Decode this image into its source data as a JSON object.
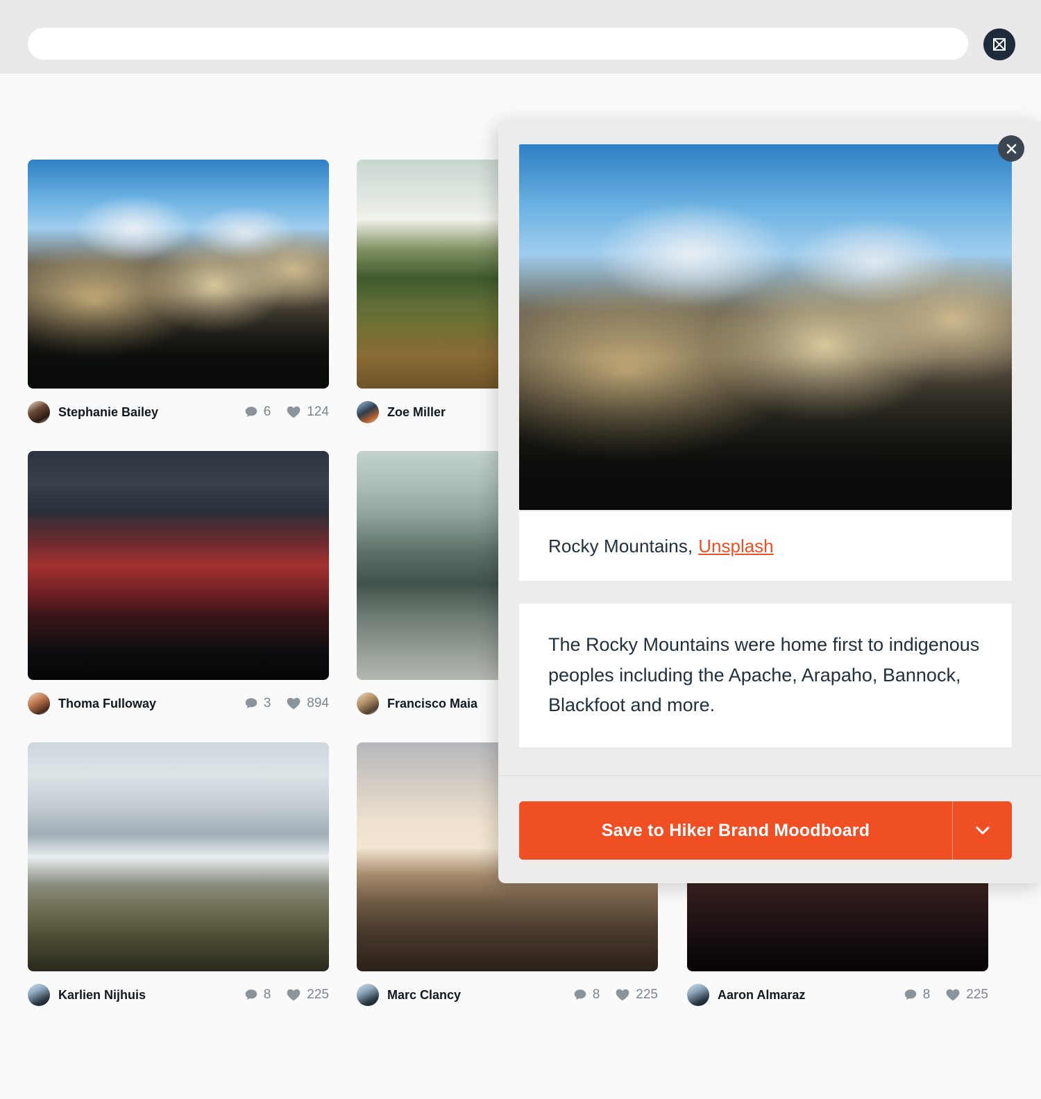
{
  "topbar": {
    "search_value": "",
    "search_placeholder": "",
    "brand_icon": "crown-m-logo-icon"
  },
  "gallery": {
    "cards": [
      {
        "id": "rocky-mountains",
        "author": "Stephanie Bailey",
        "comments": "6",
        "likes": "124",
        "photo": "pg-rocky",
        "avatar": "av-1",
        "col": 0,
        "row": 0
      },
      {
        "id": "poppy-field",
        "author": "Zoe Miller",
        "comments": "",
        "likes": "",
        "photo": "pg-poppy",
        "avatar": "av-2",
        "col": 1,
        "row": 0
      },
      {
        "id": "red-ridge",
        "author": "Thoma Fulloway",
        "comments": "3",
        "likes": "894",
        "photo": "pg-redridge",
        "avatar": "av-3",
        "col": 0,
        "row": 1
      },
      {
        "id": "foggy-forest",
        "author": "Francisco Maia",
        "comments": "",
        "likes": "",
        "photo": "pg-fog",
        "avatar": "av-4",
        "col": 1,
        "row": 1
      },
      {
        "id": "alpine-valley",
        "author": "Karlien Nijhuis",
        "comments": "8",
        "likes": "225",
        "photo": "pg-alpine",
        "avatar": "av-5",
        "col": 0,
        "row": 2
      },
      {
        "id": "cloud-peak",
        "author": "Marc Clancy",
        "comments": "8",
        "likes": "225",
        "photo": "pg-cloudpeak",
        "avatar": "av-6",
        "col": 1,
        "row": 2
      },
      {
        "id": "maroon-range",
        "author": "Aaron Almaraz",
        "comments": "8",
        "likes": "225",
        "photo": "pg-maroon",
        "avatar": "av-7",
        "col": 2,
        "row": 2
      }
    ]
  },
  "modal": {
    "close_label": "×",
    "hero_photo": "pg-rocky",
    "title": "Rocky Mountains,",
    "source": "Unsplash",
    "description": "The Rocky Mountains were home first to indigenous peoples including the Apache, Arapaho, Bannock, Blackfoot and more.",
    "save_label": "Save to Hiker Brand Moodboard",
    "caret_icon": "chevron-down-icon"
  },
  "colors": {
    "accent": "#F04E23",
    "brand_dark": "#1E2B3C",
    "text_dark": "#20303F",
    "muted": "#7B858D",
    "page_bg": "#FAFAFA",
    "topbar_bg": "#E9E9E9",
    "modal_bg": "#ECECEC"
  }
}
